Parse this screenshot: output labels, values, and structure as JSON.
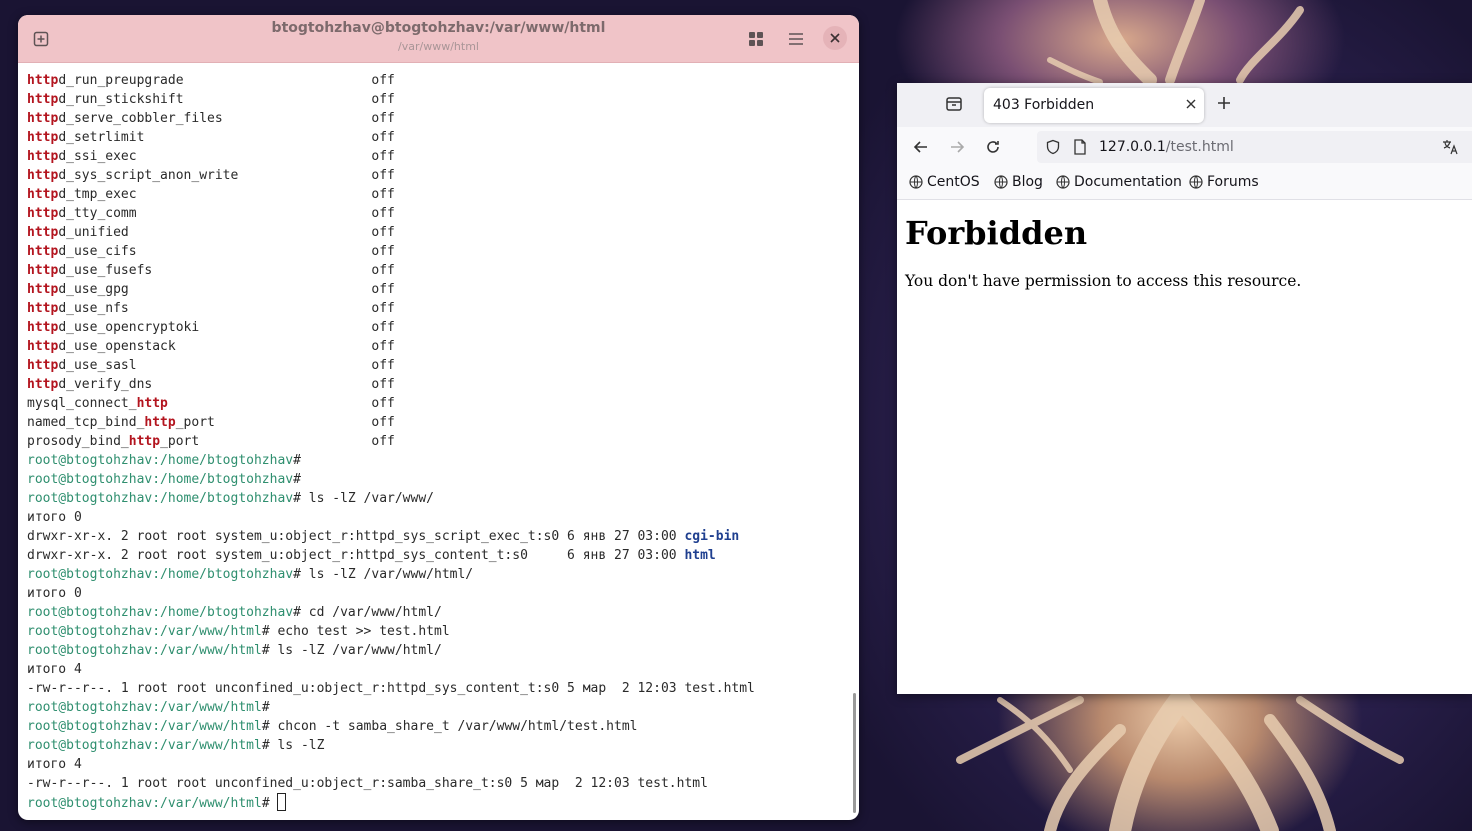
{
  "terminal": {
    "title": "btogtohzhav@btogtohzhav:/var/www/html",
    "subtitle": "/var/www/html",
    "lines": [
      {
        "t": "bool",
        "pre": "",
        "hl": "http",
        "post": "d_run_preupgrade",
        "val": "off"
      },
      {
        "t": "bool",
        "pre": "",
        "hl": "http",
        "post": "d_run_stickshift",
        "val": "off"
      },
      {
        "t": "bool",
        "pre": "",
        "hl": "http",
        "post": "d_serve_cobbler_files",
        "val": "off"
      },
      {
        "t": "bool",
        "pre": "",
        "hl": "http",
        "post": "d_setrlimit",
        "val": "off"
      },
      {
        "t": "bool",
        "pre": "",
        "hl": "http",
        "post": "d_ssi_exec",
        "val": "off"
      },
      {
        "t": "bool",
        "pre": "",
        "hl": "http",
        "post": "d_sys_script_anon_write",
        "val": "off"
      },
      {
        "t": "bool",
        "pre": "",
        "hl": "http",
        "post": "d_tmp_exec",
        "val": "off"
      },
      {
        "t": "bool",
        "pre": "",
        "hl": "http",
        "post": "d_tty_comm",
        "val": "off"
      },
      {
        "t": "bool",
        "pre": "",
        "hl": "http",
        "post": "d_unified",
        "val": "off"
      },
      {
        "t": "bool",
        "pre": "",
        "hl": "http",
        "post": "d_use_cifs",
        "val": "off"
      },
      {
        "t": "bool",
        "pre": "",
        "hl": "http",
        "post": "d_use_fusefs",
        "val": "off"
      },
      {
        "t": "bool",
        "pre": "",
        "hl": "http",
        "post": "d_use_gpg",
        "val": "off"
      },
      {
        "t": "bool",
        "pre": "",
        "hl": "http",
        "post": "d_use_nfs",
        "val": "off"
      },
      {
        "t": "bool",
        "pre": "",
        "hl": "http",
        "post": "d_use_opencryptoki",
        "val": "off"
      },
      {
        "t": "bool",
        "pre": "",
        "hl": "http",
        "post": "d_use_openstack",
        "val": "off"
      },
      {
        "t": "bool",
        "pre": "",
        "hl": "http",
        "post": "d_use_sasl",
        "val": "off"
      },
      {
        "t": "bool",
        "pre": "",
        "hl": "http",
        "post": "d_verify_dns",
        "val": "off"
      },
      {
        "t": "bool",
        "pre": "mysql_connect_",
        "hl": "http",
        "post": "",
        "val": "off"
      },
      {
        "t": "bool",
        "pre": "named_tcp_bind_",
        "hl": "http",
        "post": "_port",
        "val": "off"
      },
      {
        "t": "bool",
        "pre": "prosody_bind_",
        "hl": "http",
        "post": "_port",
        "val": "off"
      },
      {
        "t": "prompt",
        "prompt": "root@btogtohzhav:/home/btogtohzhav",
        "cmd": "# "
      },
      {
        "t": "prompt",
        "prompt": "root@btogtohzhav:/home/btogtohzhav",
        "cmd": "# "
      },
      {
        "t": "prompt",
        "prompt": "root@btogtohzhav:/home/btogtohzhav",
        "cmd": "# ls -lZ /var/www/"
      },
      {
        "t": "text",
        "text": "итого 0"
      },
      {
        "t": "ls",
        "pre": "drwxr-xr-x. 2 root root system_u:object_r:httpd_sys_script_exec_t:s0 6 янв 27 03:00 ",
        "dir": "cgi-bin"
      },
      {
        "t": "ls",
        "pre": "drwxr-xr-x. 2 root root system_u:object_r:httpd_sys_content_t:s0     6 янв 27 03:00 ",
        "dir": "html"
      },
      {
        "t": "prompt",
        "prompt": "root@btogtohzhav:/home/btogtohzhav",
        "cmd": "# ls -lZ /var/www/html/"
      },
      {
        "t": "text",
        "text": "итого 0"
      },
      {
        "t": "prompt",
        "prompt": "root@btogtohzhav:/home/btogtohzhav",
        "cmd": "# cd /var/www/html/"
      },
      {
        "t": "prompt",
        "prompt": "root@btogtohzhav:/var/www/html",
        "cmd": "# echo test >> test.html"
      },
      {
        "t": "prompt",
        "prompt": "root@btogtohzhav:/var/www/html",
        "cmd": "# ls -lZ /var/www/html/"
      },
      {
        "t": "text",
        "text": "итого 4"
      },
      {
        "t": "text",
        "text": "-rw-r--r--. 1 root root unconfined_u:object_r:httpd_sys_content_t:s0 5 мар  2 12:03 test.html"
      },
      {
        "t": "prompt",
        "prompt": "root@btogtohzhav:/var/www/html",
        "cmd": "# "
      },
      {
        "t": "prompt",
        "prompt": "root@btogtohzhav:/var/www/html",
        "cmd": "# chcon -t samba_share_t /var/www/html/test.html"
      },
      {
        "t": "prompt",
        "prompt": "root@btogtohzhav:/var/www/html",
        "cmd": "# ls -lZ"
      },
      {
        "t": "text",
        "text": "итого 4"
      },
      {
        "t": "text",
        "text": "-rw-r--r--. 1 root root unconfined_u:object_r:samba_share_t:s0 5 мар  2 12:03 test.html"
      },
      {
        "t": "prompt",
        "prompt": "root@btogtohzhav:/var/www/html",
        "cmd": "# ",
        "cursor": true
      }
    ]
  },
  "browser": {
    "tab_title": "403 Forbidden",
    "url_host": "127.0.0.1",
    "url_path": "/test.html",
    "bookmarks": [
      "CentOS",
      "Blog",
      "Documentation",
      "Forums"
    ],
    "page_heading": "Forbidden",
    "page_message": "You don't have permission to access this resource."
  },
  "icons": {
    "new_tab": "new-tab-icon",
    "grid": "grid-icon",
    "menu": "hamburger-menu-icon",
    "close": "close-icon"
  },
  "colors": {
    "terminal_header": "#f0c4c8",
    "highlight": "#b3141e",
    "prompt": "#2f8f6f",
    "directory": "#1f3f8f"
  }
}
